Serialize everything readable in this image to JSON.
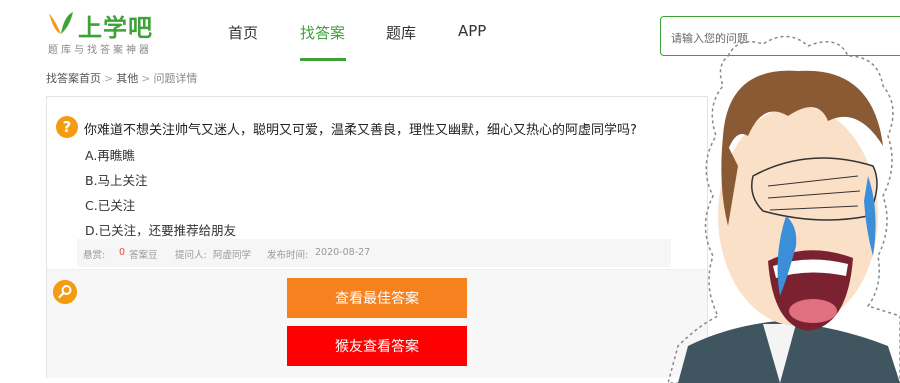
{
  "logo": {
    "title": "上学吧",
    "subtitle": "题库与找答案神器"
  },
  "nav": {
    "items": [
      {
        "label": "首页",
        "active": false
      },
      {
        "label": "找答案",
        "active": true
      },
      {
        "label": "题库",
        "active": false
      },
      {
        "label": "APP",
        "active": false
      }
    ]
  },
  "search": {
    "placeholder": "请输入您的问题"
  },
  "breadcrumb": {
    "home": "找答案首页",
    "category": "其他",
    "current": "问题详情",
    "separator": ">"
  },
  "question": {
    "text": "你难道不想关注帅气又迷人，聪明又可爱，温柔又善良，理性又幽默，细心又热心的阿虚同学吗?",
    "options": [
      "A.再瞧瞧",
      "B.马上关注",
      "C.已关注",
      "D.已关注，还要推荐给朋友"
    ],
    "meta": {
      "reward_label": "悬赏:",
      "reward_value": "0",
      "reward_unit": "答案豆",
      "asker_label": "提问人:",
      "asker": "阿虚同学",
      "date_label": "发布时间:",
      "date": "2020-08-27"
    }
  },
  "answer": {
    "best_button": "查看最佳答案",
    "friend_button": "猴友查看答案"
  },
  "colors": {
    "brand": "#3ea238",
    "orange": "#f5821f",
    "red": "#ff0000",
    "icon": "#f39c12"
  }
}
